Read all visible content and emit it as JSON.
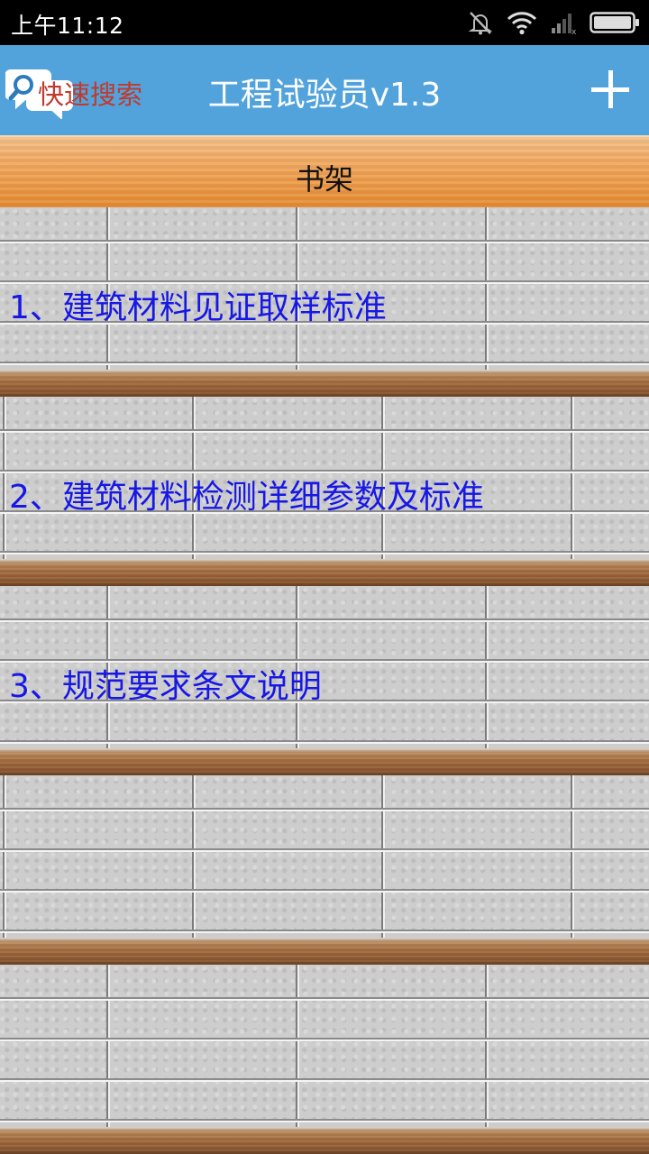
{
  "status_bar": {
    "time": "上午11:12",
    "icons": [
      "mute-icon",
      "wifi-icon",
      "signal-icon",
      "battery-icon"
    ]
  },
  "title_bar": {
    "search_label": "快速搜索",
    "app_title": "工程试验员v1.3",
    "add_icon": "plus-icon",
    "colors": {
      "background": "#52a3dc",
      "search_text": "#c0392b",
      "title_text": "#ffffff"
    }
  },
  "shelf": {
    "title": "书架",
    "link_color": "#1717e6",
    "books": [
      {
        "label": "1、建筑材料见证取样标准"
      },
      {
        "label": "2、建筑材料检测详细参数及标准"
      },
      {
        "label": "3、规范要求条文说明"
      }
    ]
  }
}
